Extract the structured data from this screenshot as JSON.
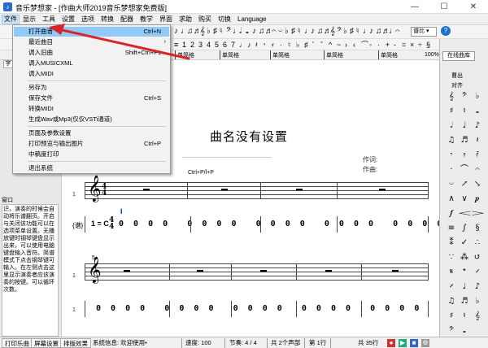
{
  "window": {
    "title": "音乐梦想家 - [作曲大师2019音乐梦想家免费版]",
    "minimize_glyph": "—",
    "maximize_glyph": "☐",
    "close_glyph": "✕",
    "app_icon_glyph": "♪"
  },
  "menubar": {
    "items": [
      "文件",
      "显示",
      "工具",
      "设置",
      "选项",
      "转换",
      "配器",
      "教学",
      "界面",
      "求助",
      "购买",
      "切换",
      "Language"
    ]
  },
  "file_menu": {
    "items": [
      {
        "label": "打开曲谱",
        "shortcut": "Ctrl+N"
      },
      {
        "label": "最近曲目",
        "shortcut": "",
        "submenu_glyph": "›"
      },
      {
        "label": "调入旧曲",
        "shortcut": "Shift+Ctrl+F1"
      },
      {
        "label": "调入MUSICXML",
        "shortcut": ""
      },
      {
        "label": "调入MIDI",
        "shortcut": ""
      },
      {
        "label": "另存为",
        "shortcut": ""
      },
      {
        "label": "保存文件",
        "shortcut": "Ctrl+S"
      },
      {
        "label": "转换MIDI",
        "shortcut": ""
      },
      {
        "label": "生成Wav或Mp3(仅仅VSTi通道)",
        "shortcut": ""
      },
      {
        "label": "页面及参数设置",
        "shortcut": ""
      },
      {
        "label": "打印预览与输出图片",
        "shortcut": "Ctrl+P"
      },
      {
        "label": "中稿度打印",
        "shortcut": ""
      },
      {
        "label": "退出系统",
        "shortcut": ""
      }
    ]
  },
  "toolbar": {
    "glyphs": [
      "♪",
      "♩",
      "♫",
      "♬",
      "𝄞",
      "♭",
      "♯",
      "♮",
      "𝄢",
      "♩",
      "𝅗𝅥",
      "𝅝",
      "♪",
      "♫",
      "♬",
      "𝄐",
      "𝄑",
      "♭",
      "♯",
      "♮",
      "♩",
      "♪",
      "♫",
      "♬",
      "𝄞",
      "𝄢",
      "♭",
      "♯",
      "♮",
      "♩",
      "♪",
      "♫",
      "♬",
      "♩",
      "𝄐"
    ],
    "zoom_value": "谱比",
    "zoom_arrow": "▾",
    "help_glyph": "?",
    "row2_glyphs": [
      "≡",
      "1",
      "2",
      "3",
      "4",
      "5",
      "6",
      "7",
      "♩",
      "♪",
      "𝄽",
      "𝄾",
      "𝄿",
      "·",
      "♮",
      "♭",
      "♯",
      "ʼ",
      "ˇ",
      "^",
      "~",
      "›",
      "‹",
      "⌒",
      "◦",
      "∙",
      "+",
      "-",
      "=",
      "×",
      "÷",
      "§"
    ]
  },
  "ruler": {
    "labels": [
      "单简格",
      "单简格",
      "单简格",
      "单简格",
      "单简格"
    ]
  },
  "score": {
    "title": "曲名没有设置",
    "lyricist": "作词:",
    "composer": "作曲:",
    "shortcut_hint": "Ctrl+P/l+P",
    "time_sig_top": "4",
    "time_sig_bottom": "4",
    "key_signature": "1 = C",
    "jianpu_bracket": "{谱}",
    "measure_number": "5",
    "row_number": "1",
    "clef_glyph": "𝄞",
    "cursor_mark": "I",
    "jianpu_line1": "0  0  0  0    0  0  0  0    0  0  0  0    0  0  0  0    0  0  0  0",
    "jianpu_line2": "0  0  0  0    0  0  0  0    0  0  0  0    0  0  0  0    0  0  0  0    0  0  0  0"
  },
  "left_panel": {
    "tab_label": "字",
    "caption": "窗口",
    "text": "识，演奏的时候会自动将乐谱翻页。开启与关闭该功能可以在选项菜单设置。无播放键时钢琴键盘显示出来，可以使用电脑键盘输入音符。简谱模式下点击钢琴键可输入。在左侧点击这里显示演奏者应该演奏的按键。可以循环次数。"
  },
  "right_panel": {
    "head_label": "在线曲库",
    "label_out": "曹出",
    "label_align": "对齐",
    "zoom_pct": "100%",
    "palette": [
      "𝄞",
      "𝄢",
      "♭",
      "♯",
      "♮",
      "𝅝",
      "𝅗𝅥",
      "♩",
      "♪",
      "♫",
      "♬",
      "𝄽",
      "𝄾",
      "𝄿",
      "𝅀",
      "·",
      "⌒",
      "𝄐",
      "𝄑",
      "↗",
      "↘",
      "∧",
      "∨",
      "𝆏",
      "𝆑",
      "𝆒",
      "𝆓",
      "≡",
      "∫",
      "§",
      "⁑",
      "✓",
      "∴",
      "∵",
      "⁂",
      "↺",
      "𝄋",
      "𝄌",
      "𝄍",
      "𝄎",
      "♩",
      "♪",
      "♫",
      "♬",
      "♭",
      "♯",
      "♮",
      "𝄞",
      "𝄢",
      "𝅝"
    ]
  },
  "statusbar": {
    "tabs": [
      "打印乐曲",
      "屏幕设置",
      "排版效果"
    ],
    "info": "系统信息: 欢迎使用•",
    "speed": "速度: 100",
    "beat": "节奏: 4 / 4",
    "parts": "共 2个声部",
    "row": "第 1行",
    "total": "共 35行"
  },
  "colors": {
    "menu_highlight": "#91c9f7",
    "arrow_red": "#d9252a",
    "accent_blue": "#1a73c9"
  }
}
